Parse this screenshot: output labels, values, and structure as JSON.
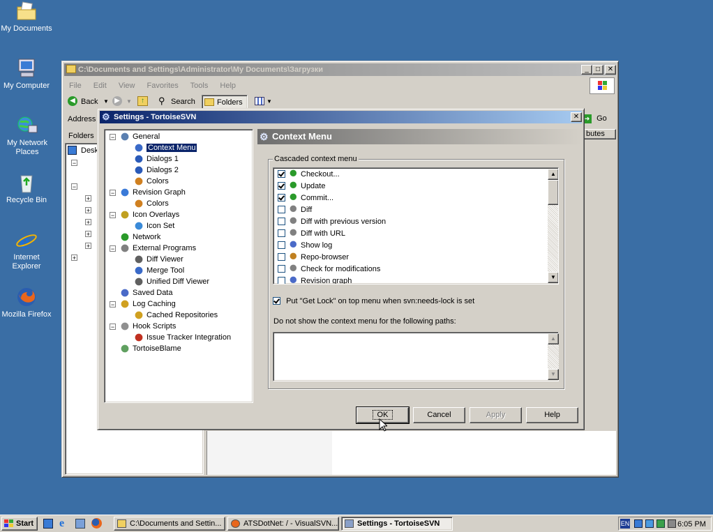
{
  "desktop_icons": [
    {
      "label": "My Documents",
      "icon": "folder-documents-icon"
    },
    {
      "label": "My Computer",
      "icon": "computer-icon"
    },
    {
      "label": "My Network Places",
      "icon": "network-icon"
    },
    {
      "label": "Recycle Bin",
      "icon": "recycle-bin-icon"
    },
    {
      "label": "Internet Explorer",
      "icon": "ie-icon"
    },
    {
      "label": "Mozilla Firefox",
      "icon": "firefox-icon"
    }
  ],
  "explorer": {
    "title": "C:\\Documents and Settings\\Administrator\\My Documents\\Загрузки",
    "menu": [
      "File",
      "Edit",
      "View",
      "Favorites",
      "Tools",
      "Help"
    ],
    "toolbar": {
      "back": "Back",
      "search": "Search",
      "folders": "Folders"
    },
    "address_label": "Address",
    "go": "Go",
    "folders_pane": "Folders",
    "tree_first": "Desk",
    "column_header": "butes"
  },
  "dialog": {
    "title": "Settings - TortoiseSVN",
    "tree": [
      {
        "label": "General",
        "level": 0,
        "expander": "−"
      },
      {
        "label": "Context Menu",
        "level": 1,
        "selected": true
      },
      {
        "label": "Dialogs 1",
        "level": 1
      },
      {
        "label": "Dialogs 2",
        "level": 1
      },
      {
        "label": "Colors",
        "level": 1
      },
      {
        "label": "Revision Graph",
        "level": 0,
        "expander": "−"
      },
      {
        "label": "Colors",
        "level": 1
      },
      {
        "label": "Icon Overlays",
        "level": 0,
        "expander": "−"
      },
      {
        "label": "Icon Set",
        "level": 1
      },
      {
        "label": "Network",
        "level": 0
      },
      {
        "label": "External Programs",
        "level": 0,
        "expander": "−"
      },
      {
        "label": "Diff Viewer",
        "level": 1
      },
      {
        "label": "Merge Tool",
        "level": 1
      },
      {
        "label": "Unified Diff Viewer",
        "level": 1
      },
      {
        "label": "Saved Data",
        "level": 0
      },
      {
        "label": "Log Caching",
        "level": 0,
        "expander": "−"
      },
      {
        "label": "Cached Repositories",
        "level": 1
      },
      {
        "label": "Hook Scripts",
        "level": 0,
        "expander": "−"
      },
      {
        "label": "Issue Tracker Integration",
        "level": 1
      },
      {
        "label": "TortoiseBlame",
        "level": 0
      }
    ],
    "page_header": "Context Menu",
    "cascaded_label": "Cascaded context menu",
    "menu_items": [
      {
        "label": "Checkout...",
        "checked": true
      },
      {
        "label": "Update",
        "checked": true
      },
      {
        "label": "Commit...",
        "checked": true
      },
      {
        "label": "Diff",
        "checked": false
      },
      {
        "label": "Diff with previous version",
        "checked": false
      },
      {
        "label": "Diff with URL",
        "checked": false
      },
      {
        "label": "Show log",
        "checked": false
      },
      {
        "label": "Repo-browser",
        "checked": false
      },
      {
        "label": "Check for modifications",
        "checked": false
      },
      {
        "label": "Revision graph",
        "checked": false
      }
    ],
    "get_lock_label": "Put \"Get Lock\" on top menu when svn:needs-lock is set",
    "get_lock_checked": true,
    "exclude_paths_label": "Do not show the context menu for the following paths:",
    "exclude_paths_value": "",
    "buttons": {
      "ok": "OK",
      "cancel": "Cancel",
      "apply": "Apply",
      "help": "Help"
    }
  },
  "taskbar": {
    "start": "Start",
    "tasks": [
      {
        "label": "C:\\Documents and Settin...",
        "active": false
      },
      {
        "label": "ATSDotNet: / - VisualSVN...",
        "active": false
      },
      {
        "label": "Settings - TortoiseSVN",
        "active": true
      }
    ],
    "lang": "EN",
    "clock": "6:05 PM"
  }
}
